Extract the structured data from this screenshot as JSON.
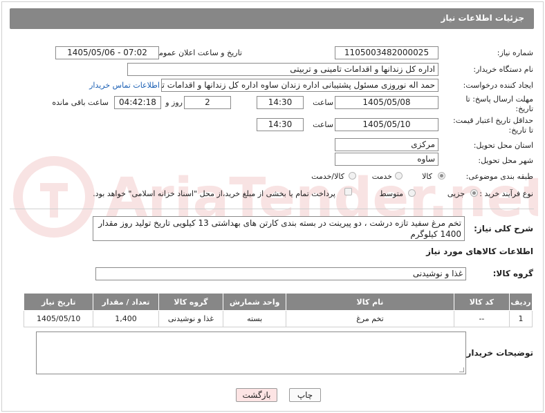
{
  "page_title": "جزئیات اطلاعات نیاز",
  "fields": {
    "need_number_label": "شماره نیاز:",
    "need_number": "1105003482000025",
    "announce_label": "تاریخ و ساعت اعلان عمومی:",
    "announce_value": "1405/05/06 - 07:02",
    "buyer_org_label": "نام دستگاه خریدار:",
    "buyer_org": "اداره کل زندانها و اقدامات تامینی و تربیتی",
    "requester_label": "ایجاد کننده درخواست:",
    "requester": "حمد اله نوروزی مسئول پشتیبانی اداره زندان ساوه اداره کل زندانها و اقدامات تامینی",
    "contact_link": "اطلاعات تماس خریدار",
    "deadline_label_1": "مهلت ارسال پاسخ: تا",
    "deadline_label_2": "تاریخ:",
    "deadline_date": "1405/05/08",
    "time_label": "ساعت",
    "deadline_time": "14:30",
    "days_value": "2",
    "days_label": "روز و",
    "remaining_time": "04:42:18",
    "remaining_label": "ساعت باقی مانده",
    "price_validity_label_1": "حداقل تاریخ اعتبار قیمت:",
    "price_validity_label_2": "تا تاریخ:",
    "price_validity_date": "1405/05/10",
    "price_validity_time": "14:30",
    "province_label": "استان محل تحویل:",
    "province": "مرکزی",
    "city_label": "شهر محل تحویل:",
    "city": "ساوه",
    "category_label": "طبقه بندی موضوعی:",
    "category_options": [
      "کالا",
      "خدمت",
      "کالا/خدمت"
    ],
    "process_label": "نوع فرآیند خرید :",
    "process_options": [
      "جزیی",
      "متوسط"
    ],
    "payment_note": "پرداخت تمام یا بخشی از مبلغ خرید،از محل \"اسناد خزانه اسلامی\" خواهد بود."
  },
  "description": {
    "label": "شرح کلی نیاز:",
    "text": "تخم مرغ سفید تازه درشت ، دو پیرینت در بسته بندی کارتن های بهداشتی 13 کیلویی تاریخ تولید روز مقدار 1400 کیلوگرم"
  },
  "goods_section_title": "اطلاعات کالاهای مورد نیاز",
  "goods_group_label": "گروه کالا:",
  "goods_group": "غذا و نوشیدنی",
  "table": {
    "headers": [
      "ردیف",
      "کد کالا",
      "نام کالا",
      "واحد شمارش",
      "گروه کالا",
      "تعداد / مقدار",
      "تاریخ نیاز"
    ],
    "rows": [
      [
        "1",
        "--",
        "تخم مرغ",
        "بسته",
        "غذا و نوشیدنی",
        "1,400",
        "1405/05/10"
      ]
    ]
  },
  "buyer_notes_label": "توضیحات خریدار:",
  "buttons": {
    "print": "چاپ",
    "back": "بازگشت"
  },
  "watermark": "AriaTender.net",
  "colors": {
    "header_bg": "#878787",
    "link": "#1a5fb4",
    "back_button_bg": "#fde4e4"
  }
}
